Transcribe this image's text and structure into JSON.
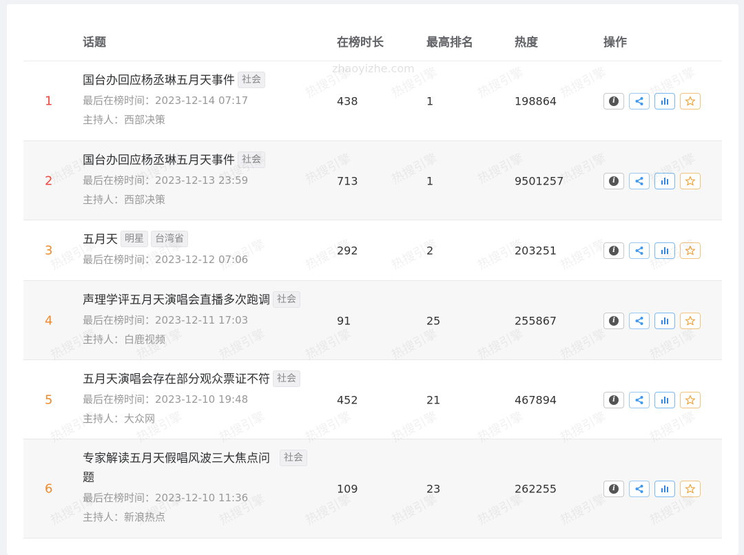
{
  "header": {
    "topic": "话题",
    "duration": "在榜时长",
    "highest_rank": "最高排名",
    "heat": "热度",
    "actions": "操作"
  },
  "labels": {
    "last_on_list_prefix": "最后在榜时间：",
    "host_prefix": "主持人："
  },
  "watermark": {
    "text": "热搜引擎",
    "url": "zhaoyizhe.com"
  },
  "colors": {
    "rank_top": "#f0483e",
    "rank_other": "#f08a2b",
    "share_blue": "#3d98f0",
    "fav_orange": "#f0a53c"
  },
  "rows": [
    {
      "rank": "1",
      "title": "国台办回应杨丞琳五月天事件",
      "tags": [
        "社会"
      ],
      "last_time": "2023-12-14 07:17",
      "host": "西部决策",
      "duration": "438",
      "highest_rank": "1",
      "heat": "198864"
    },
    {
      "rank": "2",
      "title": "国台办回应杨丞琳五月天事件",
      "tags": [
        "社会"
      ],
      "last_time": "2023-12-13 23:59",
      "host": "西部决策",
      "duration": "713",
      "highest_rank": "1",
      "heat": "9501257"
    },
    {
      "rank": "3",
      "title": "五月天",
      "tags": [
        "明星",
        "台湾省"
      ],
      "last_time": "2023-12-12 07:06",
      "host": "",
      "duration": "292",
      "highest_rank": "2",
      "heat": "203251"
    },
    {
      "rank": "4",
      "title": "声理学评五月天演唱会直播多次跑调",
      "tags": [
        "社会"
      ],
      "last_time": "2023-12-11 17:03",
      "host": "白鹿视频",
      "duration": "91",
      "highest_rank": "25",
      "heat": "255867"
    },
    {
      "rank": "5",
      "title": "五月天演唱会存在部分观众票证不符",
      "tags": [
        "社会"
      ],
      "last_time": "2023-12-10 19:48",
      "host": "大众网",
      "duration": "452",
      "highest_rank": "21",
      "heat": "467894"
    },
    {
      "rank": "6",
      "title": "专家解读五月天假唱风波三大焦点问",
      "title_cont": "题",
      "tags": [
        "社会"
      ],
      "last_time": "2023-12-10 11:36",
      "host": "新浪热点",
      "duration": "109",
      "highest_rank": "23",
      "heat": "262255"
    }
  ]
}
